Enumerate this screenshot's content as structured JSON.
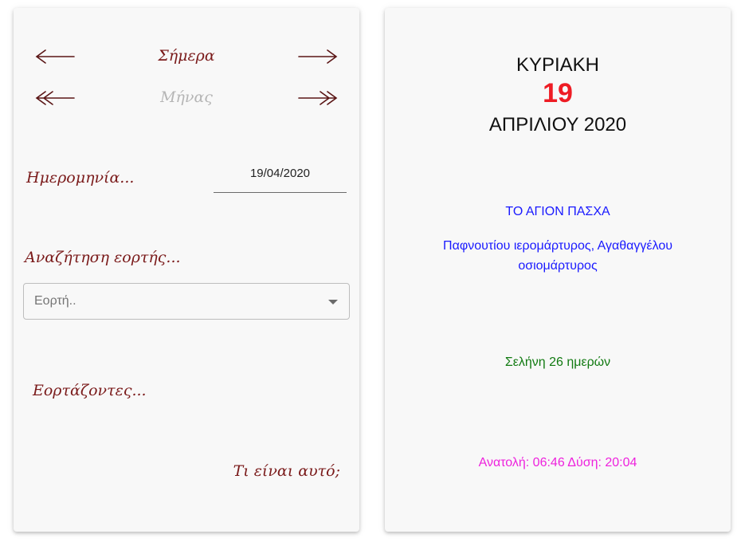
{
  "navigation": {
    "today_label": "Σήμερα",
    "month_label": "Μήνας",
    "prev_day_icon": "arrow-left-icon",
    "next_day_icon": "arrow-right-icon",
    "prev_month_icon": "double-arrow-left-icon",
    "next_month_icon": "double-arrow-right-icon"
  },
  "date_section": {
    "label": "Ημερομηνία...",
    "value": "19/04/2020"
  },
  "feast_search": {
    "label": "Αναζήτηση εορτής...",
    "placeholder": "Εορτή.."
  },
  "celebrants": {
    "label": "Εορτάζοντες..."
  },
  "help_link": "Τι είναι αυτό;",
  "day_view": {
    "weekday": "ΚΥΡΙΑΚΗ",
    "day": "19",
    "month_year": "ΑΠΡΙΛΙΟΥ 2020",
    "feast": "ΤΟ ΑΓΙΟΝ ΠΑΣΧΑ",
    "saints": "Παφνουτίου ιερομάρτυρος, Αγαθαγγέλου οσιομάρτυρος",
    "moon": "Σελήνη 26 ημερών",
    "sun": "Ανατολή: 06:46 Δύση: 20:04"
  },
  "colors": {
    "script_text": "#7a1a1a",
    "day_number": "#ee1c24",
    "feast_text": "#1a1aff",
    "moon_text": "#117a11",
    "sun_text": "#ee22dd",
    "month_label_inactive": "#b5b5b5"
  }
}
